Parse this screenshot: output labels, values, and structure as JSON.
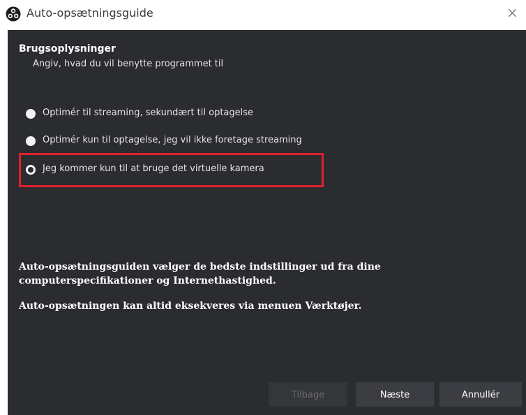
{
  "window": {
    "title": "Auto-opsætningsguide",
    "close_glyph": "×",
    "app_icon": "obs-logo-icon"
  },
  "usage": {
    "heading": "Brugsoplysninger",
    "subheading": "Angiv, hvad du vil benytte programmet til",
    "options": [
      {
        "label": "Optimér til streaming, sekundært til optagelse",
        "selected": false
      },
      {
        "label": "Optimér kun til optagelse, jeg vil ikke foretage streaming",
        "selected": false
      },
      {
        "label": "Jeg kommer kun til at bruge det virtuelle kamera",
        "selected": true
      }
    ],
    "highlight_color": "#e0202a"
  },
  "info": {
    "line1": "Auto-opsætningsguiden vælger de bedste indstillinger ud fra dine",
    "line2": "computerspecifikationer og Internethastighed.",
    "line3": "Auto-opsætningen kan altid eksekveres via menuen Værktøjer."
  },
  "buttons": {
    "back_label": "Tilbage",
    "next_label": "Næste",
    "cancel_label": "Annullér"
  }
}
